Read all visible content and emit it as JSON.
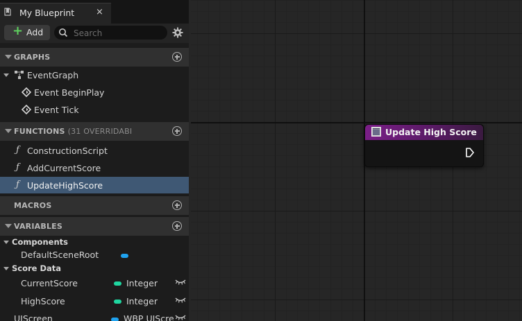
{
  "tab": {
    "title": "My Blueprint",
    "close": "×"
  },
  "toolbar": {
    "add_label": "Add",
    "search_placeholder": "Search"
  },
  "sections": {
    "graphs": {
      "title": "GRAPHS"
    },
    "functions": {
      "title": "FUNCTIONS",
      "subtitle": "(31 OVERRIDABI"
    },
    "macros": {
      "title": "MACROS"
    },
    "variables": {
      "title": "VARIABLES"
    }
  },
  "graphs": {
    "root": "EventGraph",
    "events": [
      "Event BeginPlay",
      "Event Tick"
    ]
  },
  "functions": [
    "ConstructionScript",
    "AddCurrentScore",
    "UpdateHighScore"
  ],
  "selected_function": "UpdateHighScore",
  "variables": {
    "components": {
      "label": "Components",
      "items": [
        {
          "name": "DefaultSceneRoot",
          "type": "",
          "pill_color": "#1fa3f0"
        }
      ]
    },
    "score_data": {
      "label": "Score Data",
      "items": [
        {
          "name": "CurrentScore",
          "type": "Integer",
          "pill_color": "#1fd6a0"
        },
        {
          "name": "HighScore",
          "type": "Integer",
          "pill_color": "#1fd6a0"
        }
      ]
    },
    "ungrouped": [
      {
        "name": "UIScreen",
        "type": "WBP UIScre",
        "pill_color": "#1fa3f0"
      }
    ]
  },
  "node": {
    "title": "Update High Score",
    "header_color": "#7a1e87"
  },
  "icons": {
    "tab": "blueprint-tab-icon",
    "add": "plus-icon",
    "search": "search-icon",
    "settings": "gear-icon",
    "graph": "graph-icon",
    "event": "event-diamond-icon",
    "function": "function-icon",
    "visibility": "eye-closed-icon",
    "exec": "exec-pin-icon"
  }
}
